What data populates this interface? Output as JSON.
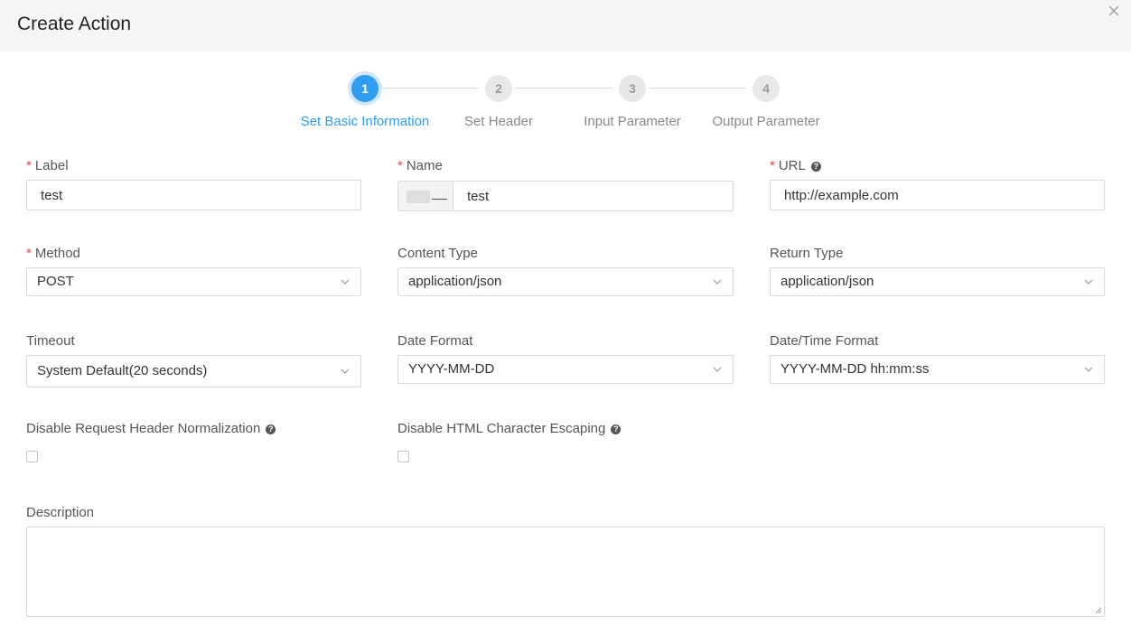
{
  "dialog": {
    "title": "Create Action"
  },
  "steps": [
    {
      "number": "1",
      "label": "Set Basic Information"
    },
    {
      "number": "2",
      "label": "Set Header"
    },
    {
      "number": "3",
      "label": "Input Parameter"
    },
    {
      "number": "4",
      "label": "Output Parameter"
    }
  ],
  "form": {
    "label": {
      "label": "Label",
      "required": "*",
      "value": "test"
    },
    "name": {
      "label": "Name",
      "required": "*",
      "prefix_suffix": "__",
      "value": "test"
    },
    "url": {
      "label": "URL",
      "required": "*",
      "help": "?",
      "value": "http://example.com"
    },
    "method": {
      "label": "Method",
      "required": "*",
      "value": "POST"
    },
    "content_type": {
      "label": "Content Type",
      "value": "application/json"
    },
    "return_type": {
      "label": "Return Type",
      "value": "application/json"
    },
    "timeout": {
      "label": "Timeout",
      "value": "System Default(20 seconds)"
    },
    "date_format": {
      "label": "Date Format",
      "value": "YYYY-MM-DD"
    },
    "datetime_format": {
      "label": "Date/Time Format",
      "value": "YYYY-MM-DD hh:mm:ss"
    },
    "disable_header_norm": {
      "label": "Disable Request Header Normalization",
      "help": "?",
      "checked": false
    },
    "disable_html_escape": {
      "label": "Disable HTML Character Escaping",
      "help": "?",
      "checked": false
    },
    "description": {
      "label": "Description",
      "value": ""
    }
  },
  "icons": {
    "close": "close-icon",
    "chevron": "chevron-down-icon",
    "help": "question-circle-icon"
  },
  "colors": {
    "accent": "#2e9df0",
    "required": "#e64545",
    "header_bg": "#f5f6f7"
  }
}
